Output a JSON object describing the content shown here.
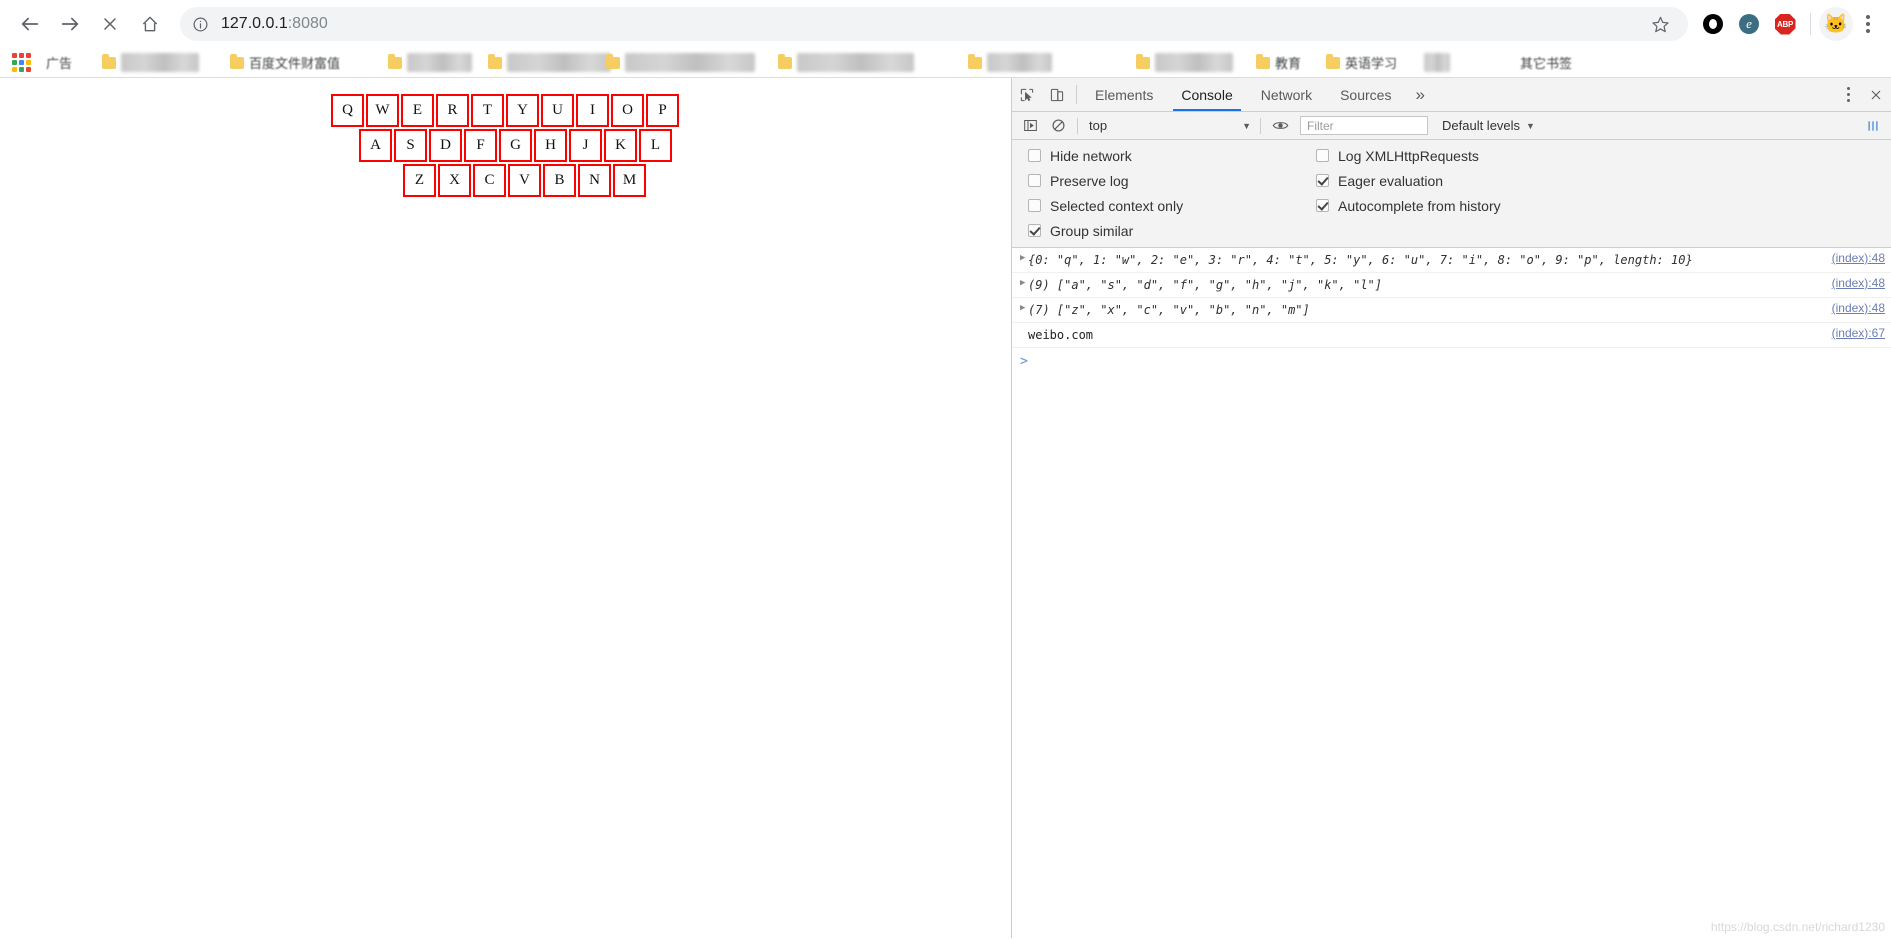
{
  "browser": {
    "nav": {
      "back_label": "Back",
      "forward_label": "Forward",
      "stop_label": "Stop",
      "home_label": "Home"
    },
    "omnibox": {
      "info_icon": "info-circle-icon",
      "url_host": "127.0.0.1",
      "url_port": ":8080",
      "full_url": "127.0.0.1:8080",
      "bookmark_icon": "star-icon"
    },
    "extensions": [
      {
        "name": "ring-extension-icon",
        "label": ""
      },
      {
        "name": "e-extension-icon",
        "label": "e"
      },
      {
        "name": "adblock-plus-icon",
        "label": "ABP"
      }
    ],
    "profile": {
      "name": "avatar",
      "glyph": "🐱"
    },
    "menu": {
      "name": "chrome-menu-icon",
      "label": ""
    }
  },
  "bookmarks": {
    "apps_icon": "apps-grid-icon",
    "items": [
      {
        "label": "广告",
        "blurred": false,
        "folder": false
      },
      {
        "label": "〇〇〇〇〇〇",
        "blurred": true,
        "folder": true
      },
      {
        "label": "百度文件财富值",
        "blurred": false,
        "folder": true
      },
      {
        "label": "〇〇〇〇〇",
        "blurred": true,
        "folder": true
      },
      {
        "label": "〇〇〇〇〇〇〇〇",
        "blurred": true,
        "folder": true
      },
      {
        "label": "〇〇〇〇〇〇〇〇〇〇",
        "blurred": true,
        "folder": true
      },
      {
        "label": "〇〇〇〇〇〇〇〇〇",
        "blurred": true,
        "folder": true
      },
      {
        "label": "〇〇〇〇〇",
        "blurred": true,
        "folder": true
      },
      {
        "label": "〇〇〇〇〇〇",
        "blurred": true,
        "folder": true
      },
      {
        "label": "教育",
        "blurred": false,
        "folder": true
      },
      {
        "label": "英语学习",
        "blurred": false,
        "folder": true
      },
      {
        "label": "〇〇",
        "blurred": true,
        "folder": true
      }
    ],
    "overflow_label": "其它书签"
  },
  "page": {
    "keyboard": {
      "rows": [
        [
          "Q",
          "W",
          "E",
          "R",
          "T",
          "Y",
          "U",
          "I",
          "O",
          "P"
        ],
        [
          "A",
          "S",
          "D",
          "F",
          "G",
          "H",
          "J",
          "K",
          "L"
        ],
        [
          "Z",
          "X",
          "C",
          "V",
          "B",
          "N",
          "M"
        ]
      ],
      "key_border_color": "#ff0000"
    }
  },
  "devtools": {
    "accent_color": "#1a73e8",
    "toolbar_icons": [
      {
        "name": "inspect-element-icon"
      },
      {
        "name": "device-toolbar-icon"
      }
    ],
    "tabs": [
      {
        "label": "Elements",
        "active": false
      },
      {
        "label": "Console",
        "active": true
      },
      {
        "label": "Network",
        "active": false
      },
      {
        "label": "Sources",
        "active": false
      }
    ],
    "more_tabs_label": "»",
    "main_menu_icon": "devtools-menu-icon",
    "close_icon": "close-icon",
    "filterbar": {
      "sidebar_toggle_icon": "console-sidebar-icon",
      "clear_console_icon": "clear-console-icon",
      "context_label": "top",
      "context_caret": "▼",
      "eye_icon": "live-expression-eye-icon",
      "filter_placeholder": "Filter",
      "filter_value": "",
      "levels_label": "Default levels",
      "levels_caret": "▼",
      "settings_icon": "console-settings-icon"
    },
    "settings": {
      "left": [
        {
          "label": "Hide network",
          "checked": false
        },
        {
          "label": "Preserve log",
          "checked": false
        },
        {
          "label": "Selected context only",
          "checked": false
        },
        {
          "label": "Group similar",
          "checked": true
        }
      ],
      "right": [
        {
          "label": "Log XMLHttpRequests",
          "checked": false
        },
        {
          "label": "Eager evaluation",
          "checked": true
        },
        {
          "label": "Autocomplete from history",
          "checked": true
        }
      ]
    },
    "console_messages": [
      {
        "expandable": true,
        "type": "object",
        "text": "{0: \"q\", 1: \"w\", 2: \"e\", 3: \"r\", 4: \"t\", 5: \"y\", 6: \"u\", 7: \"i\", 8: \"o\", 9: \"p\", length: 10}",
        "source": "(index):48"
      },
      {
        "expandable": true,
        "type": "array",
        "text": "(9) [\"a\", \"s\", \"d\", \"f\", \"g\", \"h\", \"j\", \"k\", \"l\"]",
        "source": "(index):48"
      },
      {
        "expandable": true,
        "type": "array",
        "text": "(7) [\"z\", \"x\", \"c\", \"v\", \"b\", \"n\", \"m\"]",
        "source": "(index):48"
      },
      {
        "expandable": false,
        "type": "string",
        "text": "weibo.com",
        "source": "(index):67"
      }
    ],
    "prompt": {
      "chevron": ">",
      "value": ""
    },
    "watermark": "https://blog.csdn.net/richard1230"
  }
}
